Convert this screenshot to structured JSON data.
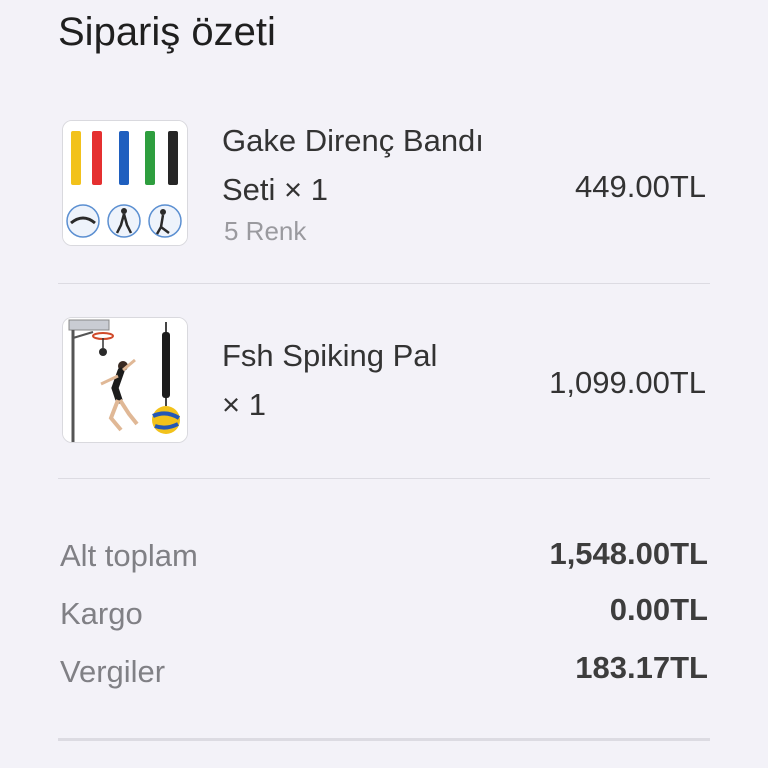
{
  "page": {
    "title": "Sipariş özeti"
  },
  "items": [
    {
      "name": "Gake Direnç Bandı Seti × 1",
      "variant": "5 Renk",
      "price": "449.00TL",
      "image_icon": "resistance-bands-product-image"
    },
    {
      "name": "Fsh Spiking Pal × 1",
      "variant": "",
      "price": "1,099.00TL",
      "image_icon": "volleyball-spiking-trainer-product-image"
    }
  ],
  "summary": {
    "subtotal_label": "Alt toplam",
    "subtotal_value": "1,548.00TL",
    "shipping_label": "Kargo",
    "shipping_value": "0.00TL",
    "tax_label": "Vergiler",
    "tax_value": "183.17TL"
  },
  "colors": {
    "background": "#f3f2f8",
    "band_colors": [
      "#f2c21b",
      "#e53030",
      "#1f5fbf",
      "#2e9e3e",
      "#262626"
    ]
  }
}
